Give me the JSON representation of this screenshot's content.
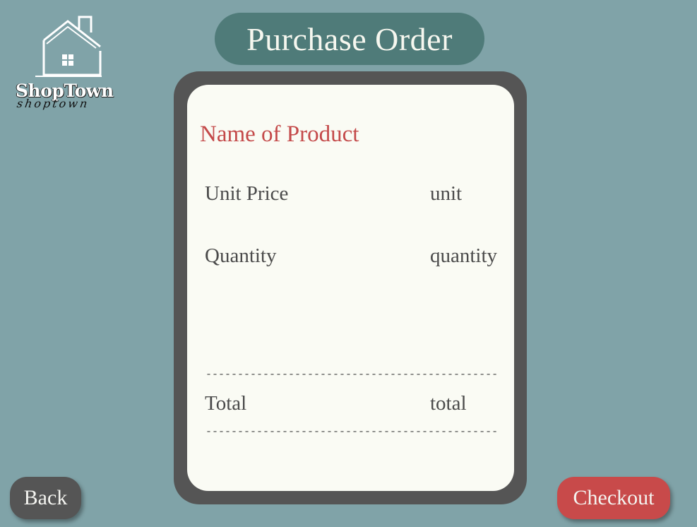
{
  "logo": {
    "brand": "ShopTown",
    "script_text": "shoptown"
  },
  "header": {
    "title": "Purchase Order"
  },
  "order": {
    "product_name": "Name of Product",
    "unit_price_label": "Unit Price",
    "unit_price_value": "unit",
    "quantity_label": "Quantity",
    "quantity_value": "quantity",
    "divider": "-------------------------------------------------",
    "total_label": "Total",
    "total_value": "total"
  },
  "buttons": {
    "back_label": "Back",
    "checkout_label": "Checkout"
  },
  "colors": {
    "background": "#80a3a8",
    "title_pill": "#4f7b79",
    "card_frame": "#555555",
    "card": "#fafbf4",
    "accent_red": "#c84a4a",
    "text_dark": "#4a4a4a"
  }
}
